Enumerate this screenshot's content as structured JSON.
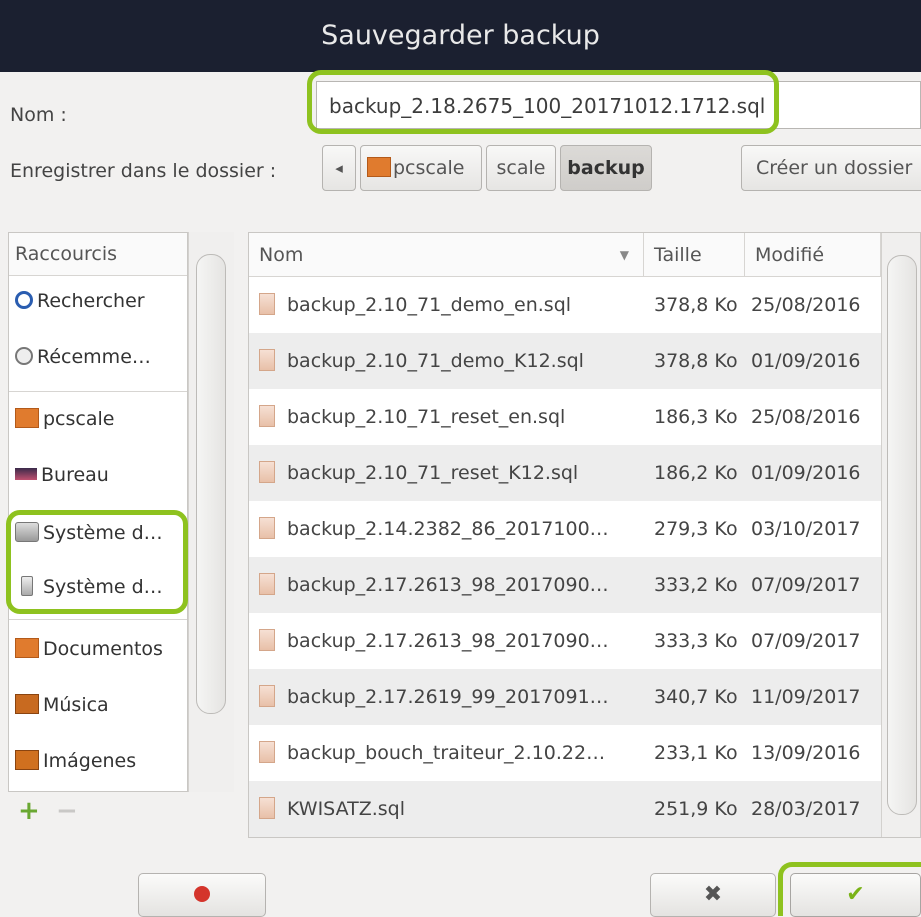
{
  "dialog": {
    "title": "Sauvegarder backup"
  },
  "name_label": "Nom :",
  "filename": "backup_2.18.2675_100_20171012.1712.sql",
  "folder_label": "Enregistrer dans le dossier :",
  "path": {
    "back": "◂",
    "crumbs": [
      "pcscale",
      "scale",
      "backup"
    ]
  },
  "create_folder_label": "Créer un dossier",
  "shortcuts": {
    "header": "Raccourcis",
    "items": [
      "Rechercher",
      "Récemme…",
      "pcscale",
      "Bureau",
      "Système d…",
      "Système d…",
      "Documentos",
      "Música",
      "Imágenes"
    ],
    "add": "+",
    "remove": "−"
  },
  "files": {
    "columns": [
      "Nom",
      "Taille",
      "Modifié"
    ],
    "rows": [
      {
        "name": "backup_2.10_71_demo_en.sql",
        "size": "378,8 Ko",
        "date": "25/08/2016"
      },
      {
        "name": "backup_2.10_71_demo_K12.sql",
        "size": "378,8 Ko",
        "date": "01/09/2016"
      },
      {
        "name": "backup_2.10_71_reset_en.sql",
        "size": "186,3 Ko",
        "date": "25/08/2016"
      },
      {
        "name": "backup_2.10_71_reset_K12.sql",
        "size": "186,2 Ko",
        "date": "01/09/2016"
      },
      {
        "name": "backup_2.14.2382_86_2017100…",
        "size": "279,3 Ko",
        "date": "03/10/2017"
      },
      {
        "name": "backup_2.17.2613_98_2017090…",
        "size": "333,2 Ko",
        "date": "07/09/2017"
      },
      {
        "name": "backup_2.17.2613_98_2017090…",
        "size": "333,3 Ko",
        "date": "07/09/2017"
      },
      {
        "name": "backup_2.17.2619_99_2017091…",
        "size": "340,7 Ko",
        "date": "11/09/2017"
      },
      {
        "name": "backup_bouch_traiteur_2.10.22…",
        "size": "233,1 Ko",
        "date": "13/09/2016"
      },
      {
        "name": "KWISATZ.sql",
        "size": "251,9 Ko",
        "date": "28/03/2017"
      }
    ]
  },
  "colors": {
    "titlebar": "#1b2030",
    "highlight": "#8ec21f",
    "cancel_red": "#d4342b",
    "ok_green": "#7ab317"
  }
}
